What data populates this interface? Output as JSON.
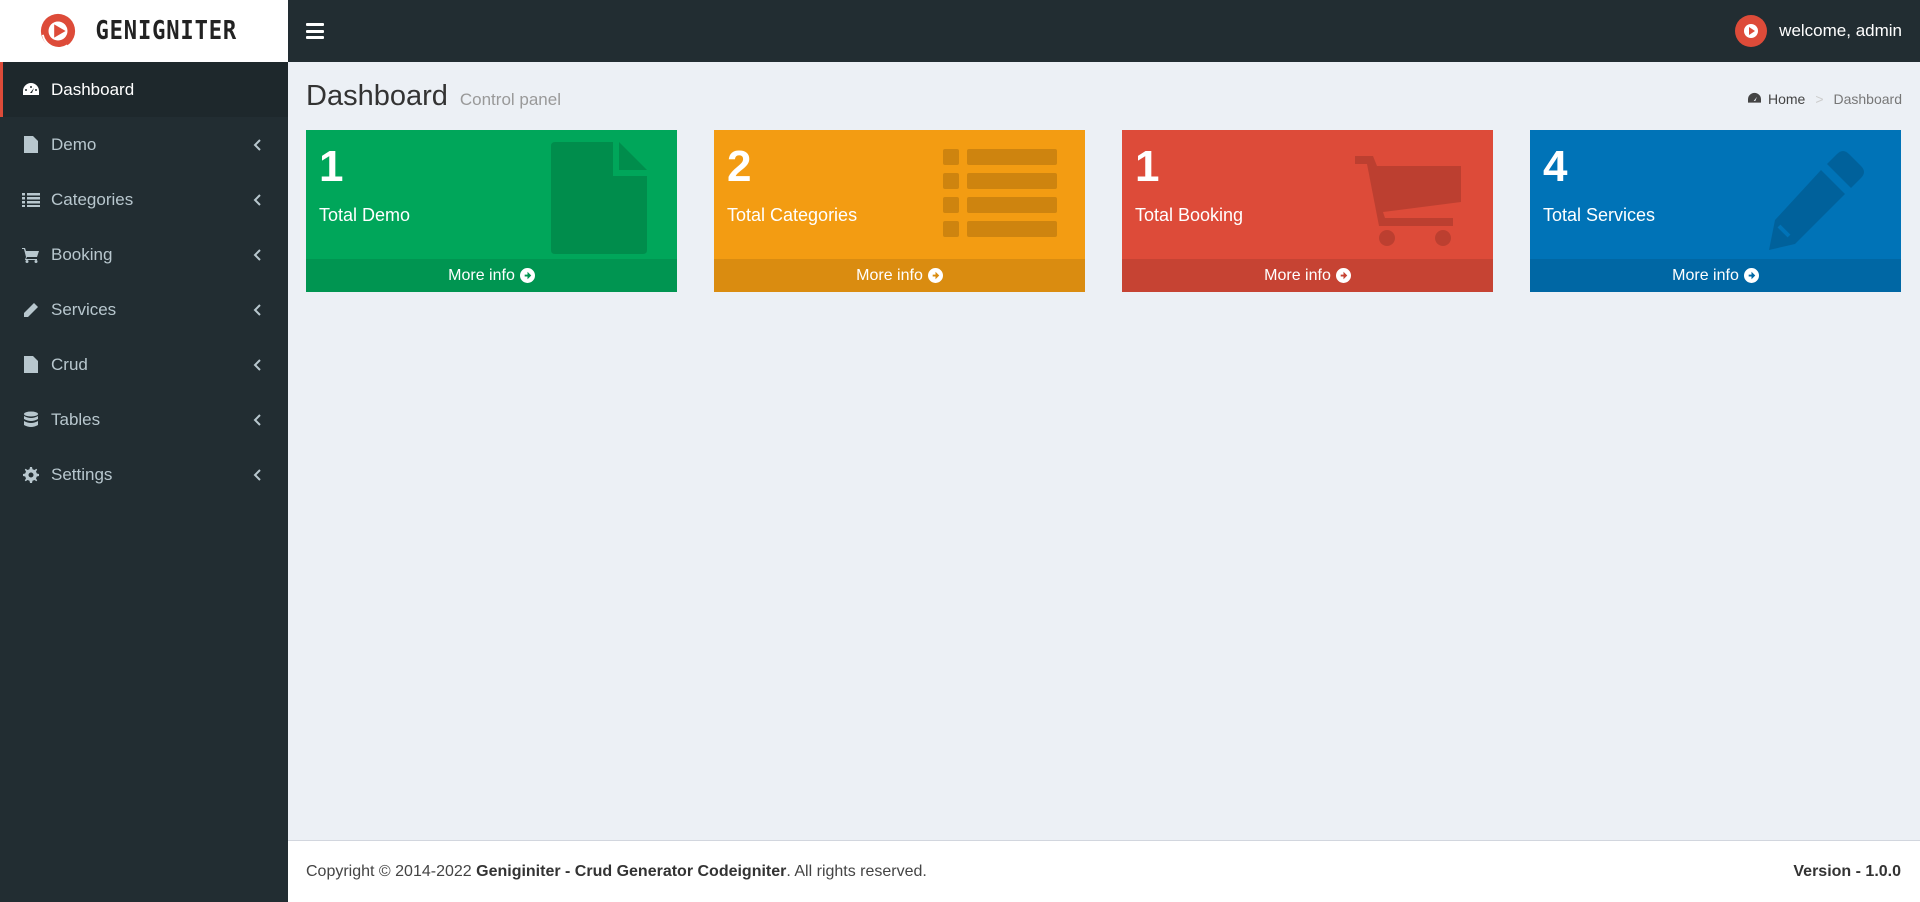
{
  "brand": {
    "name": "GENIGNITER",
    "accent": "#dd4b39"
  },
  "header": {
    "menu_icon": "hamburger-icon",
    "user_text": "welcome, admin"
  },
  "sidebar": {
    "items": [
      {
        "label": "Dashboard",
        "icon": "dashboard-icon",
        "active": true
      },
      {
        "label": "Demo",
        "icon": "file-icon"
      },
      {
        "label": "Categories",
        "icon": "list-icon"
      },
      {
        "label": "Booking",
        "icon": "cart-icon"
      },
      {
        "label": "Services",
        "icon": "pencil-icon"
      },
      {
        "label": "Crud",
        "icon": "file-icon"
      },
      {
        "label": "Tables",
        "icon": "database-icon"
      },
      {
        "label": "Settings",
        "icon": "gear-icon"
      }
    ]
  },
  "page": {
    "title": "Dashboard",
    "subtitle": "Control panel"
  },
  "breadcrumb": {
    "home": "Home",
    "separator": ">",
    "current": "Dashboard"
  },
  "boxes": [
    {
      "count": "1",
      "label": "Total Demo",
      "footer": "More info",
      "color": "#00a65a",
      "icon": "file-icon"
    },
    {
      "count": "2",
      "label": "Total Categories",
      "footer": "More info",
      "color": "#f39c12",
      "icon": "list-icon"
    },
    {
      "count": "1",
      "label": "Total Booking",
      "footer": "More info",
      "color": "#dd4b39",
      "icon": "cart-icon"
    },
    {
      "count": "4",
      "label": "Total Services",
      "footer": "More info",
      "color": "#0073b7",
      "icon": "pencil-icon"
    }
  ],
  "footer": {
    "copyright_prefix": "Copyright © 2014-2022 ",
    "copyright_name": "Geniginiter - Crud Generator Codeigniter",
    "copyright_suffix": ". All rights reserved.",
    "version": "Version - 1.0.0"
  }
}
